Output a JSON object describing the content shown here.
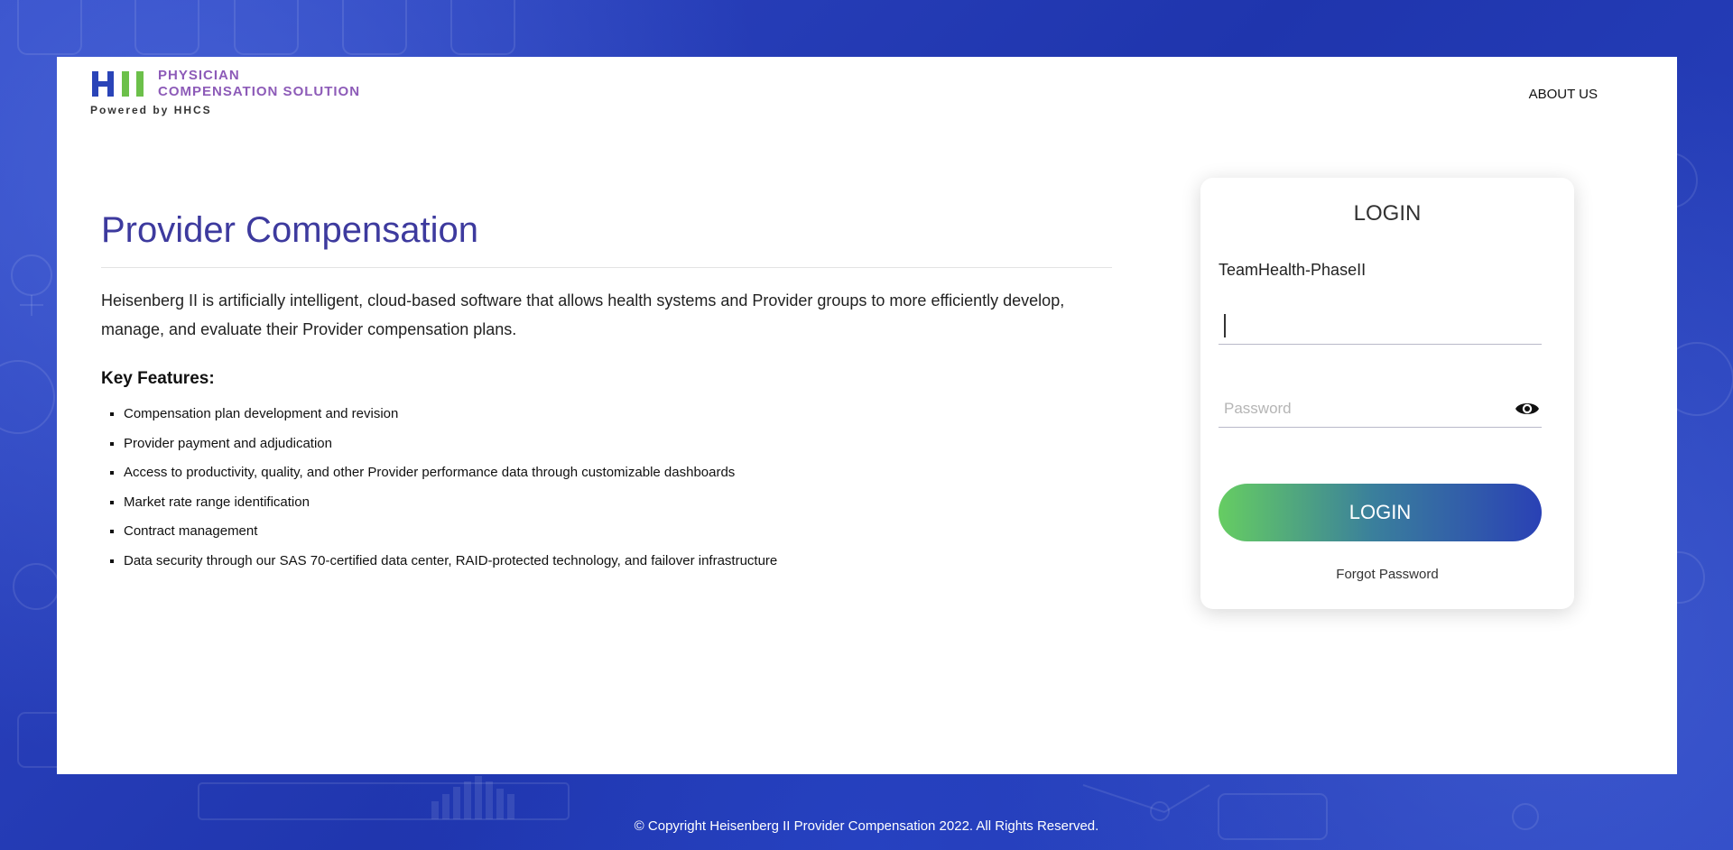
{
  "header": {
    "logo_line1": "PHYSICIAN",
    "logo_line2": "COMPENSATION SOLUTION",
    "logo_powered": "Powered by HHCS",
    "nav_about": "ABOUT US"
  },
  "main": {
    "title": "Provider Compensation",
    "description": "Heisenberg II is artificially intelligent, cloud-based software that allows health systems and Provider groups to more efficiently develop, manage, and evaluate their Provider compensation plans.",
    "features_heading": "Key Features:",
    "features": [
      "Compensation plan development and revision",
      "Provider payment and adjudication",
      "Access to productivity, quality, and other Provider performance data through customizable dashboards",
      "Market rate range identification",
      "Contract management",
      "Data security through our SAS 70-certified data center, RAID-protected technology, and failover infrastructure"
    ]
  },
  "login": {
    "title": "LOGIN",
    "tenant": "TeamHealth-PhaseII",
    "username_value": "",
    "password_placeholder": "Password",
    "button_label": "LOGIN",
    "forgot_label": "Forgot Password"
  },
  "footer": {
    "copyright": "© Copyright Heisenberg II Provider Compensation 2022. All Rights Reserved."
  },
  "colors": {
    "brand_purple": "#8d5bb8",
    "title_purple": "#3d3a9e",
    "logo_blue": "#2a44b8",
    "logo_green": "#6cc04a",
    "button_gradient_start": "#66cd62",
    "button_gradient_end": "#2a41b5",
    "background_blue": "#2a3fb8"
  },
  "icons": {
    "logo_mark": "hii-logo-mark",
    "password_toggle": "eye-icon"
  }
}
